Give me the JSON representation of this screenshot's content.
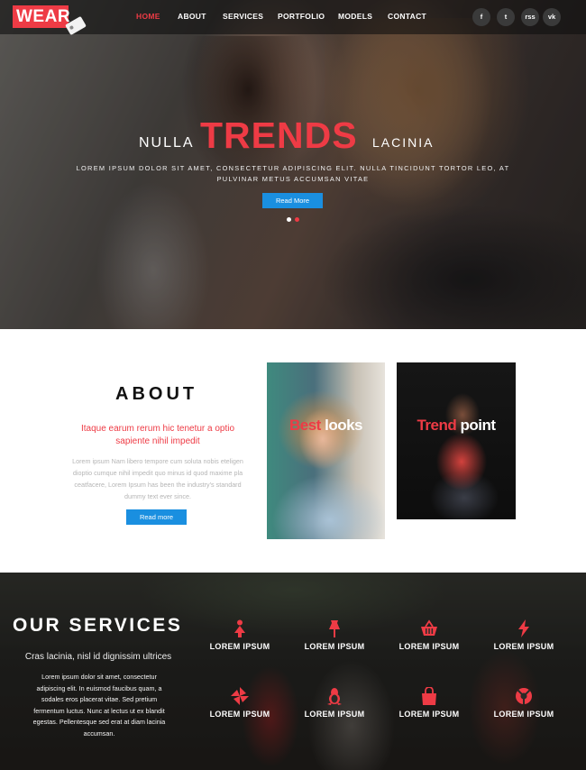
{
  "header": {
    "logo_text": "WEAR",
    "nav": [
      {
        "label": "HOME",
        "active": true
      },
      {
        "label": "ABOUT",
        "active": false
      },
      {
        "label": "SERVICES",
        "active": false
      },
      {
        "label": "PORTFOLIO",
        "active": false
      },
      {
        "label": "MODELS",
        "active": false
      },
      {
        "label": "CONTACT",
        "active": false
      }
    ],
    "social": [
      {
        "icon": "facebook-icon",
        "glyph": "f"
      },
      {
        "icon": "twitter-icon",
        "glyph": "t"
      },
      {
        "icon": "rss-icon",
        "glyph": "rss"
      },
      {
        "icon": "vk-icon",
        "glyph": "vk"
      }
    ]
  },
  "hero": {
    "title_left": "NULLA",
    "title_main": "TRENDS",
    "title_right": "LACINIA",
    "subtitle": "LOREM IPSUM DOLOR SIT AMET, CONSECTETUR ADIPISCING ELIT. NULLA TINCIDUNT TORTOR LEO, AT PULVINAR METUS ACCUMSAN VITAE",
    "button_label": "Read More",
    "slide_count": 2,
    "active_slide": 2
  },
  "about": {
    "title": "ABOUT",
    "lead": "Itaque earum rerum hic tenetur a optio sapiente nihil impedit",
    "body": "Lorem ipsum Nam libero tempore cum soluta nobis eteligen dioptio cumque nihil impedit quo minus id quod maxime pla ceatfacere, Lorem Ipsum has been the industry's standard dummy text ever since.",
    "button_label": "Read more",
    "cards": [
      {
        "word_a": "Best",
        "word_b": "looks"
      },
      {
        "word_a": "Trend",
        "word_b": "point"
      }
    ]
  },
  "services": {
    "title": "OUR SERVICES",
    "lead": "Cras lacinia, nisl id dignissim ultrices",
    "body": "Lorem ipsum dolor sit amet, consectetur adipiscing elit. In euismod faucibus quam, a sodales eros placerat vitae. Sed pretium fermentum luctus. Nunc at lectus ut ex blandit egestas. Pellentesque sed erat at diam lacinia accumsan.",
    "items": [
      {
        "label": "LOREM IPSUM",
        "icon": "woman-icon"
      },
      {
        "label": "LOREM IPSUM",
        "icon": "pushpin-icon"
      },
      {
        "label": "LOREM IPSUM",
        "icon": "shopping-basket-icon"
      },
      {
        "label": "LOREM IPSUM",
        "icon": "bolt-icon"
      },
      {
        "label": "LOREM IPSUM",
        "icon": "pinwheel-icon"
      },
      {
        "label": "LOREM IPSUM",
        "icon": "linux-icon"
      },
      {
        "label": "LOREM IPSUM",
        "icon": "shopping-bag-icon"
      },
      {
        "label": "LOREM IPSUM",
        "icon": "life-ring-icon"
      }
    ]
  },
  "colors": {
    "accent_red": "#ee3b45",
    "button_blue": "#1a8fe0"
  }
}
